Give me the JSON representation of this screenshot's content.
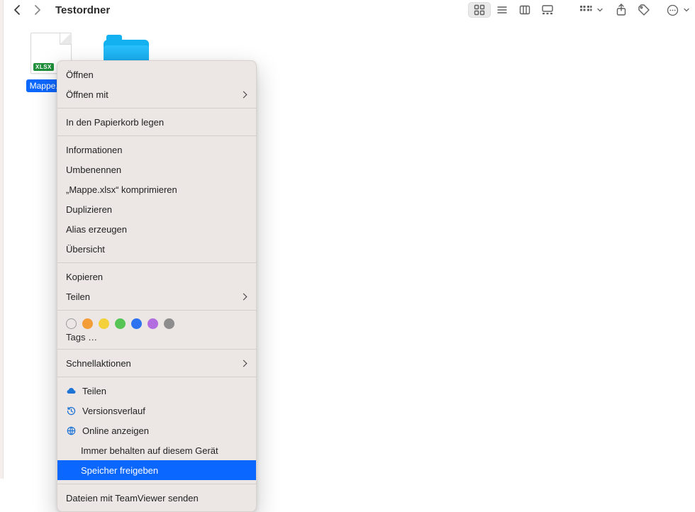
{
  "toolbar": {
    "title": "Testordner",
    "back_enabled": true,
    "forward_enabled": false
  },
  "items": {
    "file": {
      "label": "Mappe.xlsx",
      "badge": "XLSX",
      "selected": true
    },
    "folder": {
      "label": ""
    }
  },
  "context_menu": {
    "open": "Öffnen",
    "open_with": "Öffnen mit",
    "trash": "In den Papierkorb legen",
    "info": "Informationen",
    "rename": "Umbenennen",
    "compress": "„Mappe.xlsx“ komprimieren",
    "duplicate": "Duplizieren",
    "alias": "Alias erzeugen",
    "quicklook": "Übersicht",
    "copy": "Kopieren",
    "share": "Teilen",
    "tags_more": "Tags …",
    "quickactions": "Schnellaktionen",
    "od_share": "Teilen",
    "od_history": "Versionsverlauf",
    "od_online": "Online anzeigen",
    "od_keep": "Immer behalten auf diesem Gerät",
    "od_free": "Speicher freigeben",
    "tv_send": "Dateien mit TeamViewer senden"
  },
  "tag_colors": [
    "#f29d38",
    "#f4d03a",
    "#56c556",
    "#2d72f0",
    "#b26de0",
    "#8d8d8d"
  ]
}
